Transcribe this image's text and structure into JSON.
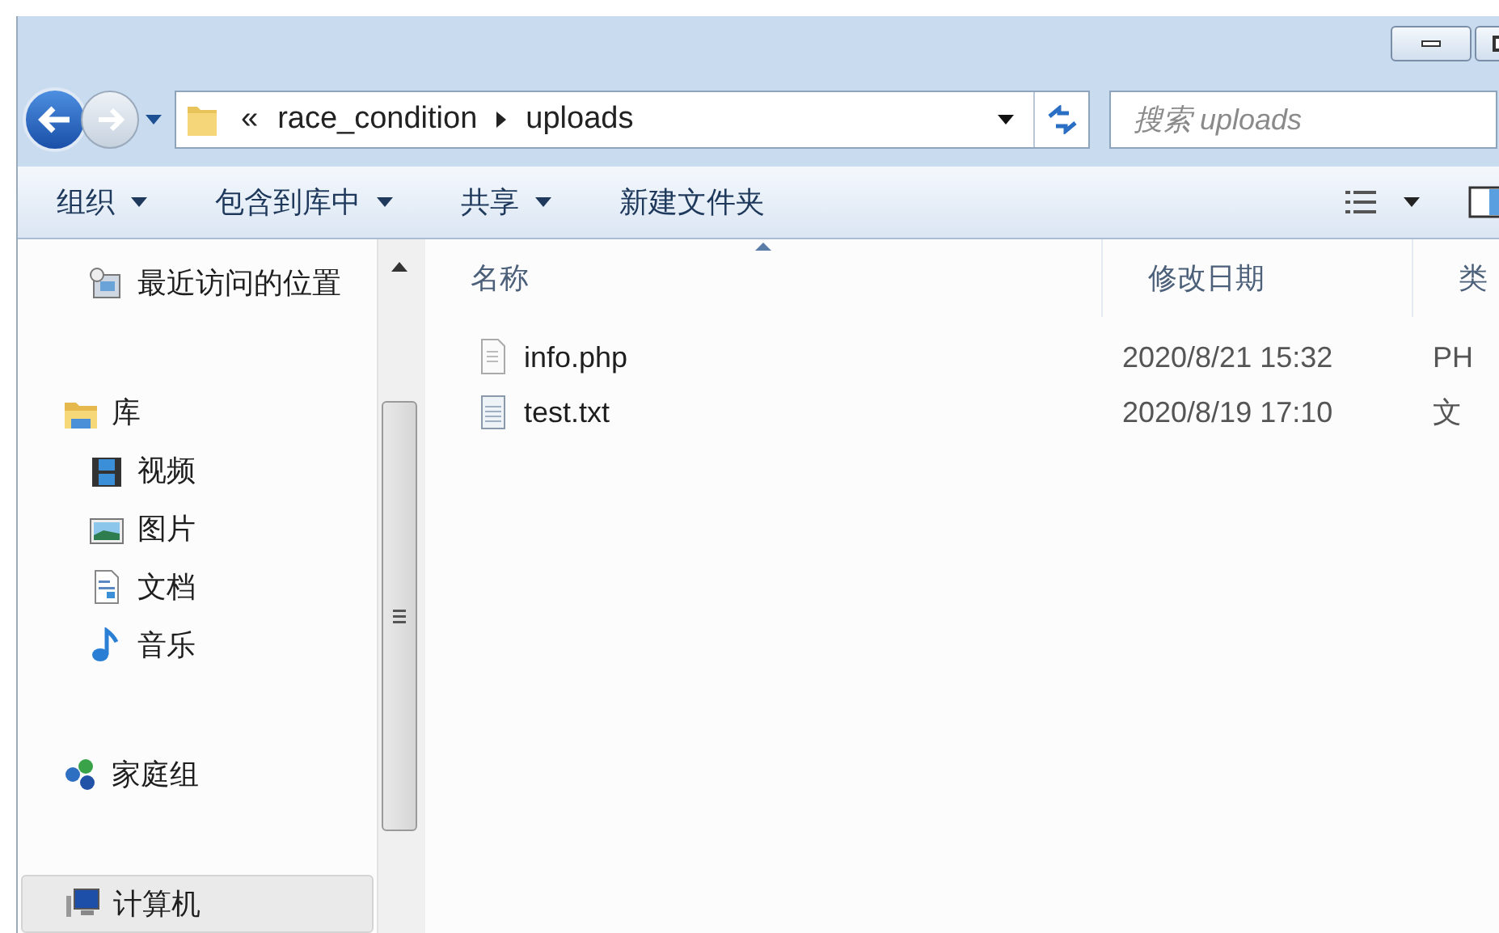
{
  "address": {
    "overflow": "«",
    "path": [
      "race_condition",
      "uploads"
    ]
  },
  "search": {
    "placeholder": "搜索 uploads"
  },
  "toolbar": [
    {
      "label": "组织",
      "dropdown": true
    },
    {
      "label": "包含到库中",
      "dropdown": true
    },
    {
      "label": "共享",
      "dropdown": true
    },
    {
      "label": "新建文件夹",
      "dropdown": false
    }
  ],
  "sidebar": {
    "items": [
      {
        "label": "最近访问的位置",
        "kind": "recent",
        "selected": false
      },
      {
        "label": "库",
        "kind": "library",
        "selected": false,
        "children": [
          {
            "label": "视频",
            "kind": "video",
            "selected": false
          },
          {
            "label": "图片",
            "kind": "pictures",
            "selected": false
          },
          {
            "label": "文档",
            "kind": "documents",
            "selected": false
          },
          {
            "label": "音乐",
            "kind": "music",
            "selected": false
          }
        ]
      },
      {
        "label": "家庭组",
        "kind": "homegroup",
        "selected": false
      },
      {
        "label": "计算机",
        "kind": "computer",
        "selected": true
      }
    ]
  },
  "table": {
    "columns": [
      {
        "label": "名称",
        "sorted": true
      },
      {
        "label": "修改日期",
        "sorted": false
      },
      {
        "label": "类",
        "sorted": false
      }
    ],
    "rows": [
      {
        "kind": "php",
        "name": "info.php",
        "modified": "2020/8/21 15:32",
        "type": "PH"
      },
      {
        "kind": "txt",
        "name": "test.txt",
        "modified": "2020/8/19 17:10",
        "type": "文"
      }
    ]
  }
}
